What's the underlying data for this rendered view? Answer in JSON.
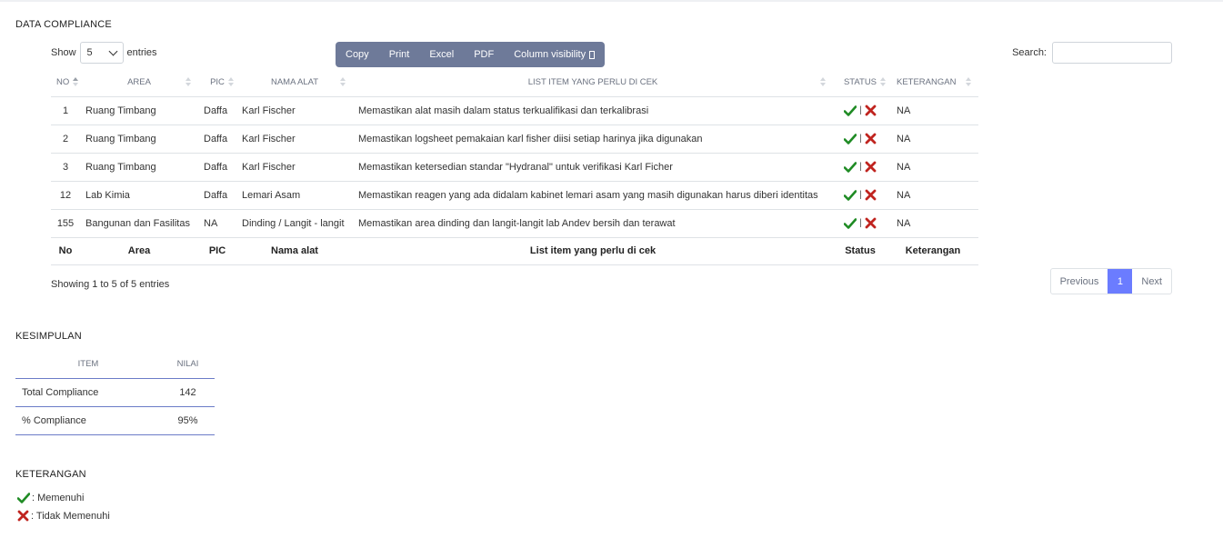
{
  "sections": {
    "data_compliance": "DATA COMPLIANCE",
    "kesimpulan": "KESIMPULAN",
    "keterangan": "KETERANGAN"
  },
  "toolbar": {
    "show_label": "Show",
    "entries_label": "entries",
    "page_length": "5",
    "search_label": "Search:",
    "search_value": "",
    "buttons": [
      "Copy",
      "Print",
      "Excel",
      "PDF",
      "Column visibility"
    ]
  },
  "table": {
    "headers": [
      "NO",
      "AREA",
      "PIC",
      "NAMA ALAT",
      "LIST ITEM YANG PERLU DI CEK",
      "STATUS",
      "KETERANGAN"
    ],
    "footers": [
      "No",
      "Area",
      "PIC",
      "Nama alat",
      "List item yang perlu di cek",
      "Status",
      "Keterangan"
    ],
    "rows": [
      {
        "no": "1",
        "area": "Ruang Timbang",
        "pic": "Daffa",
        "alat": "Karl Fischer",
        "item": "Memastikan alat masih dalam status terkualifikasi dan terkalibrasi",
        "sep": "|",
        "ket": "NA"
      },
      {
        "no": "2",
        "area": "Ruang Timbang",
        "pic": "Daffa",
        "alat": "Karl Fischer",
        "item": "Memastikan logsheet pemakaian karl fisher diisi setiap harinya jika digunakan",
        "sep": "|",
        "ket": "NA"
      },
      {
        "no": "3",
        "area": "Ruang Timbang",
        "pic": "Daffa",
        "alat": "Karl Fischer",
        "item": "Memastikan ketersedian standar \"Hydranal\" untuk verifikasi Karl Ficher",
        "sep": "|",
        "ket": "NA"
      },
      {
        "no": "12",
        "area": "Lab Kimia",
        "pic": "Daffa",
        "alat": "Lemari Asam",
        "item": "Memastikan reagen yang ada didalam kabinet lemari asam yang masih digunakan harus diberi identitas",
        "sep": "|",
        "ket": "NA"
      },
      {
        "no": "155",
        "area": "Bangunan dan Fasilitas",
        "pic": "NA",
        "alat": "Dinding / Langit - langit",
        "item": "Memastikan area dinding dan langit-langit lab Andev bersih dan terawat",
        "sep": "|",
        "ket": "NA"
      }
    ],
    "info": "Showing 1 to 5 of 5 entries",
    "pager": {
      "prev": "Previous",
      "page": "1",
      "next": "Next"
    }
  },
  "summary": {
    "headers": [
      "ITEM",
      "NILAI"
    ],
    "rows": [
      {
        "item": "Total Compliance",
        "nilai": "142"
      },
      {
        "item": "% Compliance",
        "nilai": "95%"
      }
    ]
  },
  "legend": [
    {
      "icon": "check-icon",
      "label": ": Memenuhi"
    },
    {
      "icon": "cross-icon",
      "label": ": Tidak Memenuhi"
    }
  ],
  "colors": {
    "accent": "#6b7cff",
    "button_bg": "#6e7a99",
    "check": "#1f8b24",
    "cross": "#c0241f"
  }
}
